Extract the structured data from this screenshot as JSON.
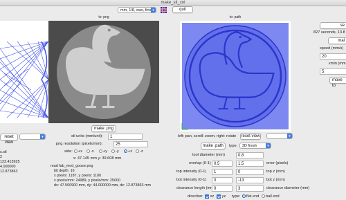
{
  "window": {
    "title": "make_stl_cnl"
  },
  "top_bar": {
    "mode_select": "mm, 1/8, wax, finis",
    "quit_label": "quit"
  },
  "left_panel": {
    "reset_view_label": "reset view",
    "info_lines": [
      "s.stl",
      "2",
      "123.413925",
      "4.000000",
      "12.873863"
    ]
  },
  "png_panel": {
    "header": "to: png",
    "make_png_label": "make .png",
    "stl_units_label": "stl units (mm/unit):",
    "stl_units_value": "1",
    "png_resolution_label": "png resolution (pixels/mm):",
    "png_resolution_value": "25",
    "side_label": "side:",
    "side_options": [
      "+x",
      "-x",
      "+y",
      "-y",
      "+z",
      "-z"
    ],
    "side_selected": "+z",
    "cursor_readout": "x: 47.145 mm  y: 39.608 mm",
    "read_info": [
      "read fab_mod_goose.png",
      "  bit depth: 16",
      "  x pixels: 1187, y pixels: 1100",
      "  x pixels/mm: 24989, y pixels/mm: 25000",
      "  dx: 47.500900 mm, dy: 44.000000 mm, dz: 12.873863 mm"
    ]
  },
  "path_panel": {
    "header": "to: path",
    "nav_hint": "left: pan, scroll: zoom, right: rotate",
    "reset_view_label": "reset view",
    "make_path_label": "make .path",
    "type_label": "type:",
    "type_value": "3D finish",
    "tool_diameter_label": "tool diameter (mm)",
    "tool_diameter_value": "0.8",
    "overlap_label": "overlap (0-1)",
    "overlap_value": "0.5",
    "error_value": "1.5",
    "error_label": "error (pixels)",
    "top_intensity_label": "top intensity (0-1)",
    "top_intensity_value": "1",
    "top_z_value": "0",
    "top_z_label": "top z (mm)",
    "bot_intensity_label": "bot intensity (0-1)",
    "bot_intensity_value": "0",
    "bot_z_value": "-13",
    "bot_z_label": "bot z (mm)",
    "clearance_length_label": "clearance length (mm)",
    "clearance_length_value": "0",
    "clearance_diameter_value": "3",
    "clearance_diameter_label": "clearance diameter (mm)",
    "direction_label": "direction:",
    "dir_xz_label": "xz",
    "dir_yz_label": "yz",
    "endmill_type_label": "type:",
    "flat_end_label": "flat end",
    "ball_end_label": "ball end"
  },
  "right_panel": {
    "send_label": "se",
    "status": "827 seconds, 13.8",
    "make_label": "mal",
    "speed_label": "speed (mm/s)",
    "speed_value": "20",
    "xmin_label": "xmin (mm",
    "xmin_value": "5",
    "move_label": "move to"
  },
  "colors": {
    "accent": "#3a7de0",
    "toolpath": "#4a5ae8",
    "png_bg": "#4b4b4b"
  }
}
